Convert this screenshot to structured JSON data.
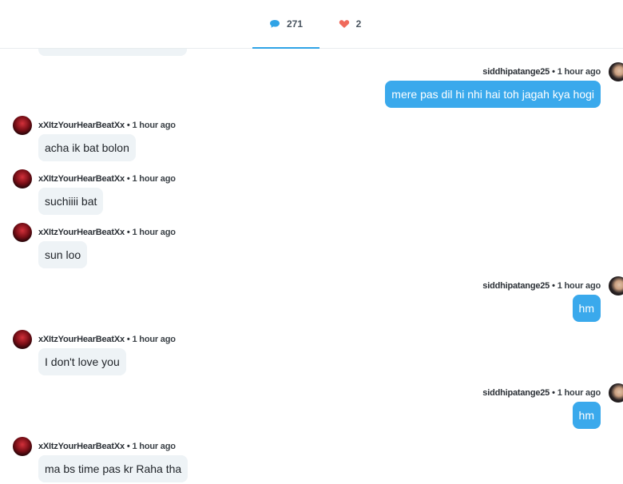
{
  "tabs": {
    "comments": {
      "count": "271",
      "icon": "comment-icon",
      "color": "#2fa3e6"
    },
    "likes": {
      "count": "2",
      "icon": "heart-icon",
      "color": "#f06a5b"
    }
  },
  "colors": {
    "outgoing_bubble": "#3aa9ec",
    "incoming_bubble": "#eef3f6",
    "active_tab": "#2fa3e6"
  },
  "messages": [
    {
      "direction": "out",
      "user": "siddhipatange25",
      "time": "1 hour ago",
      "text": "mere pas dil hi nhi hai toh jagah kya hogi"
    },
    {
      "direction": "in",
      "user": "xXItzYourHearBeatXx",
      "time": "1 hour ago",
      "text": "acha ik bat bolon"
    },
    {
      "direction": "in",
      "user": "xXItzYourHearBeatXx",
      "time": "1 hour ago",
      "text": "suchiiii bat"
    },
    {
      "direction": "in",
      "user": "xXItzYourHearBeatXx",
      "time": "1 hour ago",
      "text": "sun loo"
    },
    {
      "direction": "out",
      "user": "siddhipatange25",
      "time": "1 hour ago",
      "text": "hm"
    },
    {
      "direction": "in",
      "user": "xXItzYourHearBeatXx",
      "time": "1 hour ago",
      "text": "I don't love you"
    },
    {
      "direction": "out",
      "user": "siddhipatange25",
      "time": "1 hour ago",
      "text": "hm"
    },
    {
      "direction": "in",
      "user": "xXItzYourHearBeatXx",
      "time": "1 hour ago",
      "text": "ma bs time pas kr Raha tha"
    }
  ]
}
